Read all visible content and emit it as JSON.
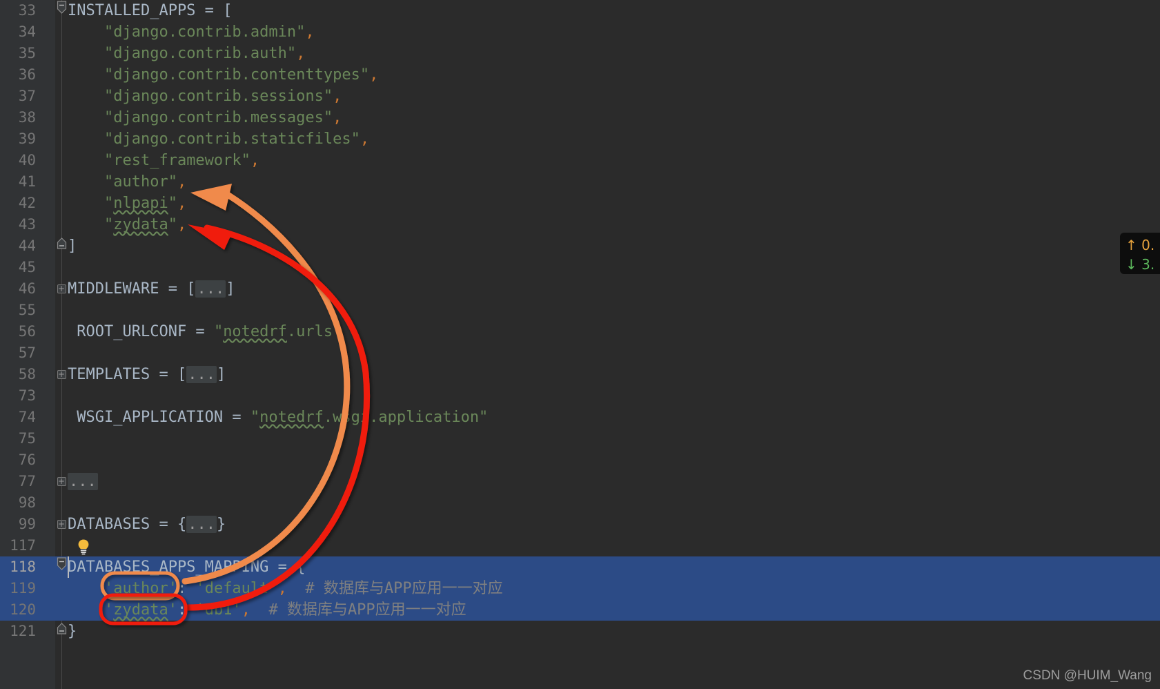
{
  "app": {
    "theme": "darcula",
    "colors": {
      "background": "#2b2b2b",
      "gutter_background": "#313335",
      "selection": "#2c4b86",
      "string": "#6a8759",
      "identifier": "#a9b7c6",
      "comment": "#808080",
      "comma": "#cc7832",
      "line_number": "#757575",
      "arrow_orange": "#f08a4b",
      "arrow_red": "#f01f11",
      "folded_placeholder": "#3d4143"
    }
  },
  "editor": {
    "lines": [
      {
        "num": "33",
        "fold": "minus-top",
        "indent": 0,
        "tokens": [
          {
            "t": "INSTALLED_APPS",
            "c": "ident"
          },
          {
            "t": " = ",
            "c": "punct"
          },
          {
            "t": "[",
            "c": "punct"
          }
        ]
      },
      {
        "num": "34",
        "fold": "",
        "indent": 0,
        "tokens": [
          {
            "t": "    ",
            "c": "punct"
          },
          {
            "t": "\"django.contrib.admin\"",
            "c": "str"
          },
          {
            "t": ",",
            "c": "comma"
          }
        ]
      },
      {
        "num": "35",
        "fold": "",
        "indent": 0,
        "tokens": [
          {
            "t": "    ",
            "c": "punct"
          },
          {
            "t": "\"django.contrib.auth\"",
            "c": "str"
          },
          {
            "t": ",",
            "c": "comma"
          }
        ]
      },
      {
        "num": "36",
        "fold": "",
        "indent": 0,
        "tokens": [
          {
            "t": "    ",
            "c": "punct"
          },
          {
            "t": "\"django.contrib.contenttypes\"",
            "c": "str"
          },
          {
            "t": ",",
            "c": "comma"
          }
        ]
      },
      {
        "num": "37",
        "fold": "",
        "indent": 0,
        "tokens": [
          {
            "t": "    ",
            "c": "punct"
          },
          {
            "t": "\"django.contrib.sessions\"",
            "c": "str"
          },
          {
            "t": ",",
            "c": "comma"
          }
        ]
      },
      {
        "num": "38",
        "fold": "",
        "indent": 0,
        "tokens": [
          {
            "t": "    ",
            "c": "punct"
          },
          {
            "t": "\"django.contrib.messages\"",
            "c": "str"
          },
          {
            "t": ",",
            "c": "comma"
          }
        ]
      },
      {
        "num": "39",
        "fold": "",
        "indent": 0,
        "tokens": [
          {
            "t": "    ",
            "c": "punct"
          },
          {
            "t": "\"django.contrib.staticfiles\"",
            "c": "str"
          },
          {
            "t": ",",
            "c": "comma"
          }
        ]
      },
      {
        "num": "40",
        "fold": "",
        "indent": 0,
        "tokens": [
          {
            "t": "    ",
            "c": "punct"
          },
          {
            "t": "\"rest_framework\"",
            "c": "str"
          },
          {
            "t": ",",
            "c": "comma"
          }
        ]
      },
      {
        "num": "41",
        "fold": "",
        "indent": 0,
        "tokens": [
          {
            "t": "    ",
            "c": "punct"
          },
          {
            "t": "\"author\"",
            "c": "str"
          },
          {
            "t": ",",
            "c": "comma"
          }
        ]
      },
      {
        "num": "42",
        "fold": "",
        "indent": 0,
        "tokens": [
          {
            "t": "    \"",
            "c": "str"
          },
          {
            "t": "nlpapi",
            "c": "str squig"
          },
          {
            "t": "\"",
            "c": "str"
          },
          {
            "t": ",",
            "c": "comma"
          }
        ]
      },
      {
        "num": "43",
        "fold": "",
        "indent": 0,
        "tokens": [
          {
            "t": "    \"",
            "c": "str"
          },
          {
            "t": "zydata",
            "c": "str squig"
          },
          {
            "t": "\"",
            "c": "str"
          },
          {
            "t": ",",
            "c": "comma"
          }
        ]
      },
      {
        "num": "44",
        "fold": "minus-bottom",
        "indent": 0,
        "tokens": [
          {
            "t": "]",
            "c": "punct"
          }
        ]
      },
      {
        "num": "45",
        "fold": "",
        "indent": 0,
        "tokens": []
      },
      {
        "num": "46",
        "fold": "plus",
        "indent": 0,
        "tokens": [
          {
            "t": "MIDDLEWARE",
            "c": "ident"
          },
          {
            "t": " = ",
            "c": "punct"
          },
          {
            "t": "[",
            "c": "punct"
          },
          {
            "t": "...",
            "c": "folded"
          },
          {
            "t": "]",
            "c": "punct"
          }
        ]
      },
      {
        "num": "55",
        "fold": "",
        "indent": 0,
        "tokens": []
      },
      {
        "num": "56",
        "fold": "",
        "indent": 0,
        "tokens": [
          {
            "t": " ROOT_URLCONF",
            "c": "ident"
          },
          {
            "t": " = ",
            "c": "punct"
          },
          {
            "t": "\"",
            "c": "str"
          },
          {
            "t": "notedrf",
            "c": "str squig"
          },
          {
            "t": ".urls\"",
            "c": "str"
          }
        ]
      },
      {
        "num": "57",
        "fold": "",
        "indent": 0,
        "tokens": []
      },
      {
        "num": "58",
        "fold": "plus",
        "indent": 0,
        "tokens": [
          {
            "t": "TEMPLATES",
            "c": "ident"
          },
          {
            "t": " = ",
            "c": "punct"
          },
          {
            "t": "[",
            "c": "punct"
          },
          {
            "t": "...",
            "c": "folded"
          },
          {
            "t": "]",
            "c": "punct"
          }
        ]
      },
      {
        "num": "73",
        "fold": "",
        "indent": 0,
        "tokens": []
      },
      {
        "num": "74",
        "fold": "",
        "indent": 0,
        "tokens": [
          {
            "t": " WSGI_APPLICATION",
            "c": "ident"
          },
          {
            "t": " = ",
            "c": "punct"
          },
          {
            "t": "\"",
            "c": "str"
          },
          {
            "t": "notedrf",
            "c": "str squig"
          },
          {
            "t": ".wsgi.application\"",
            "c": "str"
          }
        ]
      },
      {
        "num": "75",
        "fold": "",
        "indent": 0,
        "tokens": []
      },
      {
        "num": "76",
        "fold": "",
        "indent": 0,
        "tokens": []
      },
      {
        "num": "77",
        "fold": "plus",
        "indent": 0,
        "tokens": [
          {
            "t": "...",
            "c": "folded"
          }
        ]
      },
      {
        "num": "98",
        "fold": "",
        "indent": 0,
        "tokens": []
      },
      {
        "num": "99",
        "fold": "plus",
        "indent": 0,
        "tokens": [
          {
            "t": "DATABASES",
            "c": "ident"
          },
          {
            "t": " = ",
            "c": "punct"
          },
          {
            "t": "{",
            "c": "punct"
          },
          {
            "t": "...",
            "c": "folded"
          },
          {
            "t": "}",
            "c": "punct"
          }
        ]
      },
      {
        "num": "117",
        "fold": "",
        "indent": 0,
        "bulb": true,
        "tokens": []
      },
      {
        "num": "118",
        "fold": "minus-top",
        "selected": true,
        "current": true,
        "indent": 0,
        "tokens": [
          {
            "t": "DATABASES_APPS_MAPPING",
            "c": "ident"
          },
          {
            "t": " = ",
            "c": "punct"
          },
          {
            "t": "{",
            "c": "punct"
          }
        ]
      },
      {
        "num": "119",
        "fold": "",
        "selected": true,
        "indent": 0,
        "tokens": [
          {
            "t": "    ",
            "c": "punct"
          },
          {
            "t": "'author'",
            "c": "str"
          },
          {
            "t": ": ",
            "c": "punct"
          },
          {
            "t": "'default'",
            "c": "str"
          },
          {
            "t": ",",
            "c": "comma"
          },
          {
            "t": "  # 数据库与APP应用一一对应",
            "c": "comment"
          }
        ]
      },
      {
        "num": "120",
        "fold": "",
        "selected": true,
        "indent": 0,
        "tokens": [
          {
            "t": "    '",
            "c": "str"
          },
          {
            "t": "zydata",
            "c": "str squig"
          },
          {
            "t": "'",
            "c": "str"
          },
          {
            "t": ": ",
            "c": "punct"
          },
          {
            "t": "'db1'",
            "c": "str"
          },
          {
            "t": ",",
            "c": "comma"
          },
          {
            "t": "  # 数据库与APP应用一一对应",
            "c": "comment"
          }
        ]
      },
      {
        "num": "121",
        "fold": "minus-bottom",
        "selected_char": true,
        "indent": 0,
        "tokens": [
          {
            "t": "}",
            "c": "punct"
          }
        ]
      }
    ]
  },
  "annotations": {
    "orange_arrow": {
      "name": "author-mapping-arrow",
      "color": "#f08a4b",
      "from_label": "'author' in DATABASES_APPS_MAPPING (line 119)",
      "to_label": "\"author\" in INSTALLED_APPS (line 41)"
    },
    "red_arrow": {
      "name": "zydata-mapping-arrow",
      "color": "#f01f11",
      "from_label": "'zydata' in DATABASES_APPS_MAPPING (line 120)",
      "to_label": "\"zydata\" in INSTALLED_APPS (line 43)"
    },
    "orange_ellipse": {
      "name": "author-key-highlight",
      "color": "#f08a4b",
      "target": "'author'"
    },
    "red_ellipse": {
      "name": "zydata-key-highlight",
      "color": "#f01f11",
      "target": "'zydata'"
    }
  },
  "net_widget": {
    "upload": "0.",
    "download": "3.",
    "up_icon": "arrow-up-icon",
    "down_icon": "arrow-down-icon"
  },
  "watermark": {
    "text": "CSDN @HUIM_Wang"
  }
}
